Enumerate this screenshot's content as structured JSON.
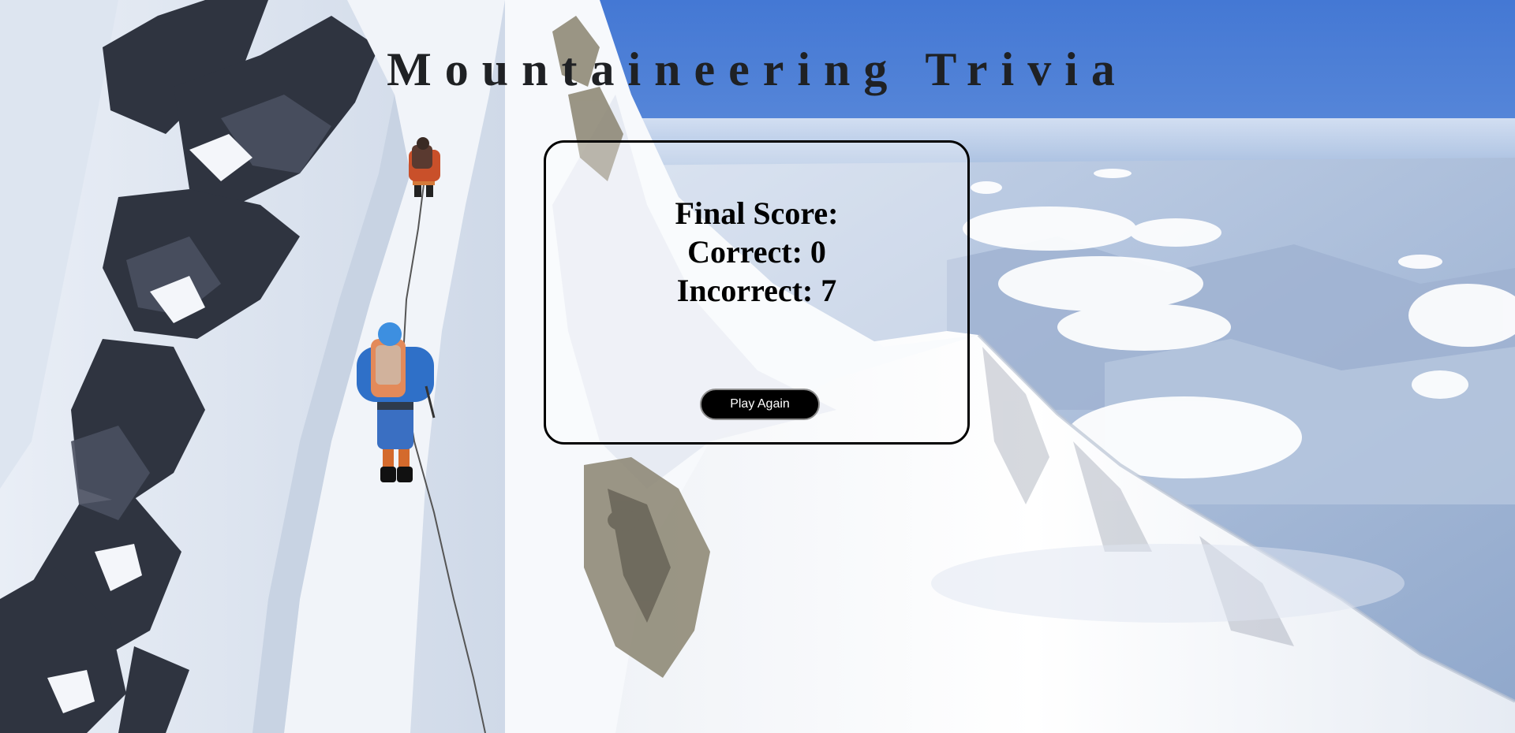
{
  "page": {
    "title": "Mountaineering Trivia"
  },
  "results": {
    "heading": "Final Score:",
    "correct_label": "Correct: 0",
    "incorrect_label": "Incorrect: 7",
    "correct_count": 0,
    "incorrect_count": 7
  },
  "actions": {
    "play_again_label": "Play Again"
  },
  "colors": {
    "title_text": "#1f2124",
    "card_border": "#000000",
    "button_background": "#000000",
    "button_text": "#ffffff",
    "sky": "#4f84d8",
    "snow": "#f2f4f7"
  }
}
